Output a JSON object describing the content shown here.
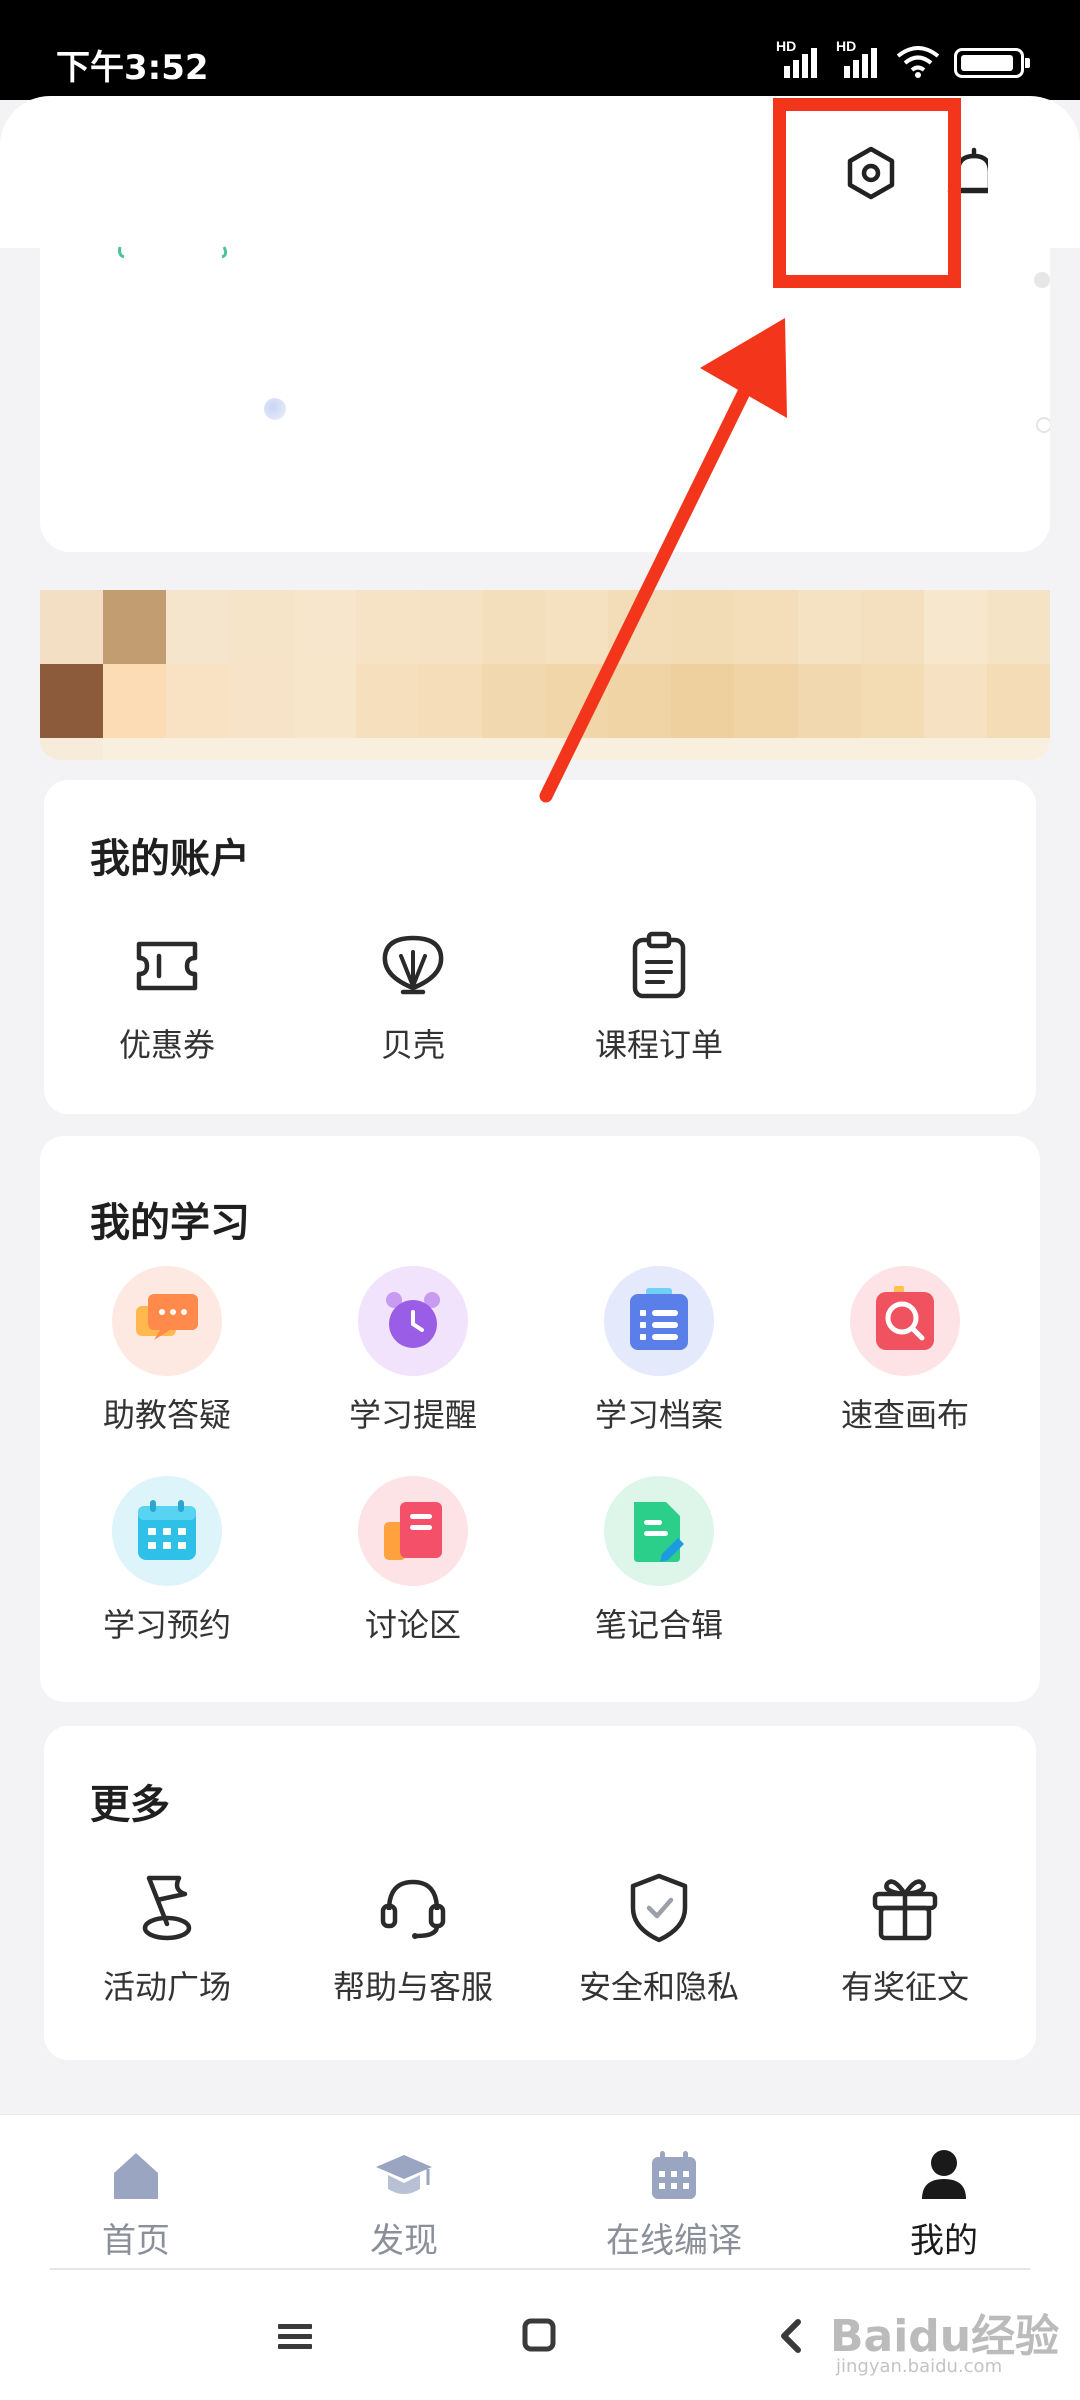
{
  "status_bar": {
    "time": "下午3:52",
    "network_1": "HD",
    "network_2": "HD",
    "battery": "80"
  },
  "header": {
    "settings_icon": "hexagon-gear-icon",
    "notifications_icon": "bell-icon"
  },
  "annotation": {
    "highlight_color": "#f2351b"
  },
  "account": {
    "title": "我的账户",
    "items": [
      {
        "label": "优惠券",
        "icon": "ticket-icon"
      },
      {
        "label": "贝壳",
        "icon": "shell-icon"
      },
      {
        "label": "课程订单",
        "icon": "clipboard-icon"
      }
    ]
  },
  "study": {
    "title": "我的学习",
    "items": [
      {
        "label": "助教答疑",
        "icon": "chat-bubbles-icon",
        "bg": "#fde9e2"
      },
      {
        "label": "学习提醒",
        "icon": "alarm-clock-icon",
        "bg": "#f1e3fb"
      },
      {
        "label": "学习档案",
        "icon": "list-document-icon",
        "bg": "#e4e9fb"
      },
      {
        "label": "速查画布",
        "icon": "search-doc-icon",
        "bg": "#fde3e6"
      },
      {
        "label": "学习预约",
        "icon": "calendar-icon",
        "bg": "#ddf4fa"
      },
      {
        "label": "讨论区",
        "icon": "discussion-icon",
        "bg": "#fde3e6"
      },
      {
        "label": "笔记合辑",
        "icon": "note-pen-icon",
        "bg": "#def6ea"
      }
    ]
  },
  "more": {
    "title": "更多",
    "items": [
      {
        "label": "活动广场",
        "icon": "flag-icon"
      },
      {
        "label": "帮助与客服",
        "icon": "headset-icon"
      },
      {
        "label": "安全和隐私",
        "icon": "shield-check-icon"
      },
      {
        "label": "有奖征文",
        "icon": "gift-icon"
      }
    ]
  },
  "bottom_nav": {
    "items": [
      {
        "label": "首页",
        "icon": "home-icon"
      },
      {
        "label": "发现",
        "icon": "graduation-cap-icon"
      },
      {
        "label": "在线编译",
        "icon": "calendar-grid-icon"
      },
      {
        "label": "我的",
        "icon": "person-icon",
        "active": true
      }
    ]
  },
  "watermark": {
    "text": "Baidu经验",
    "sub": "jingyan.baidu.com"
  }
}
